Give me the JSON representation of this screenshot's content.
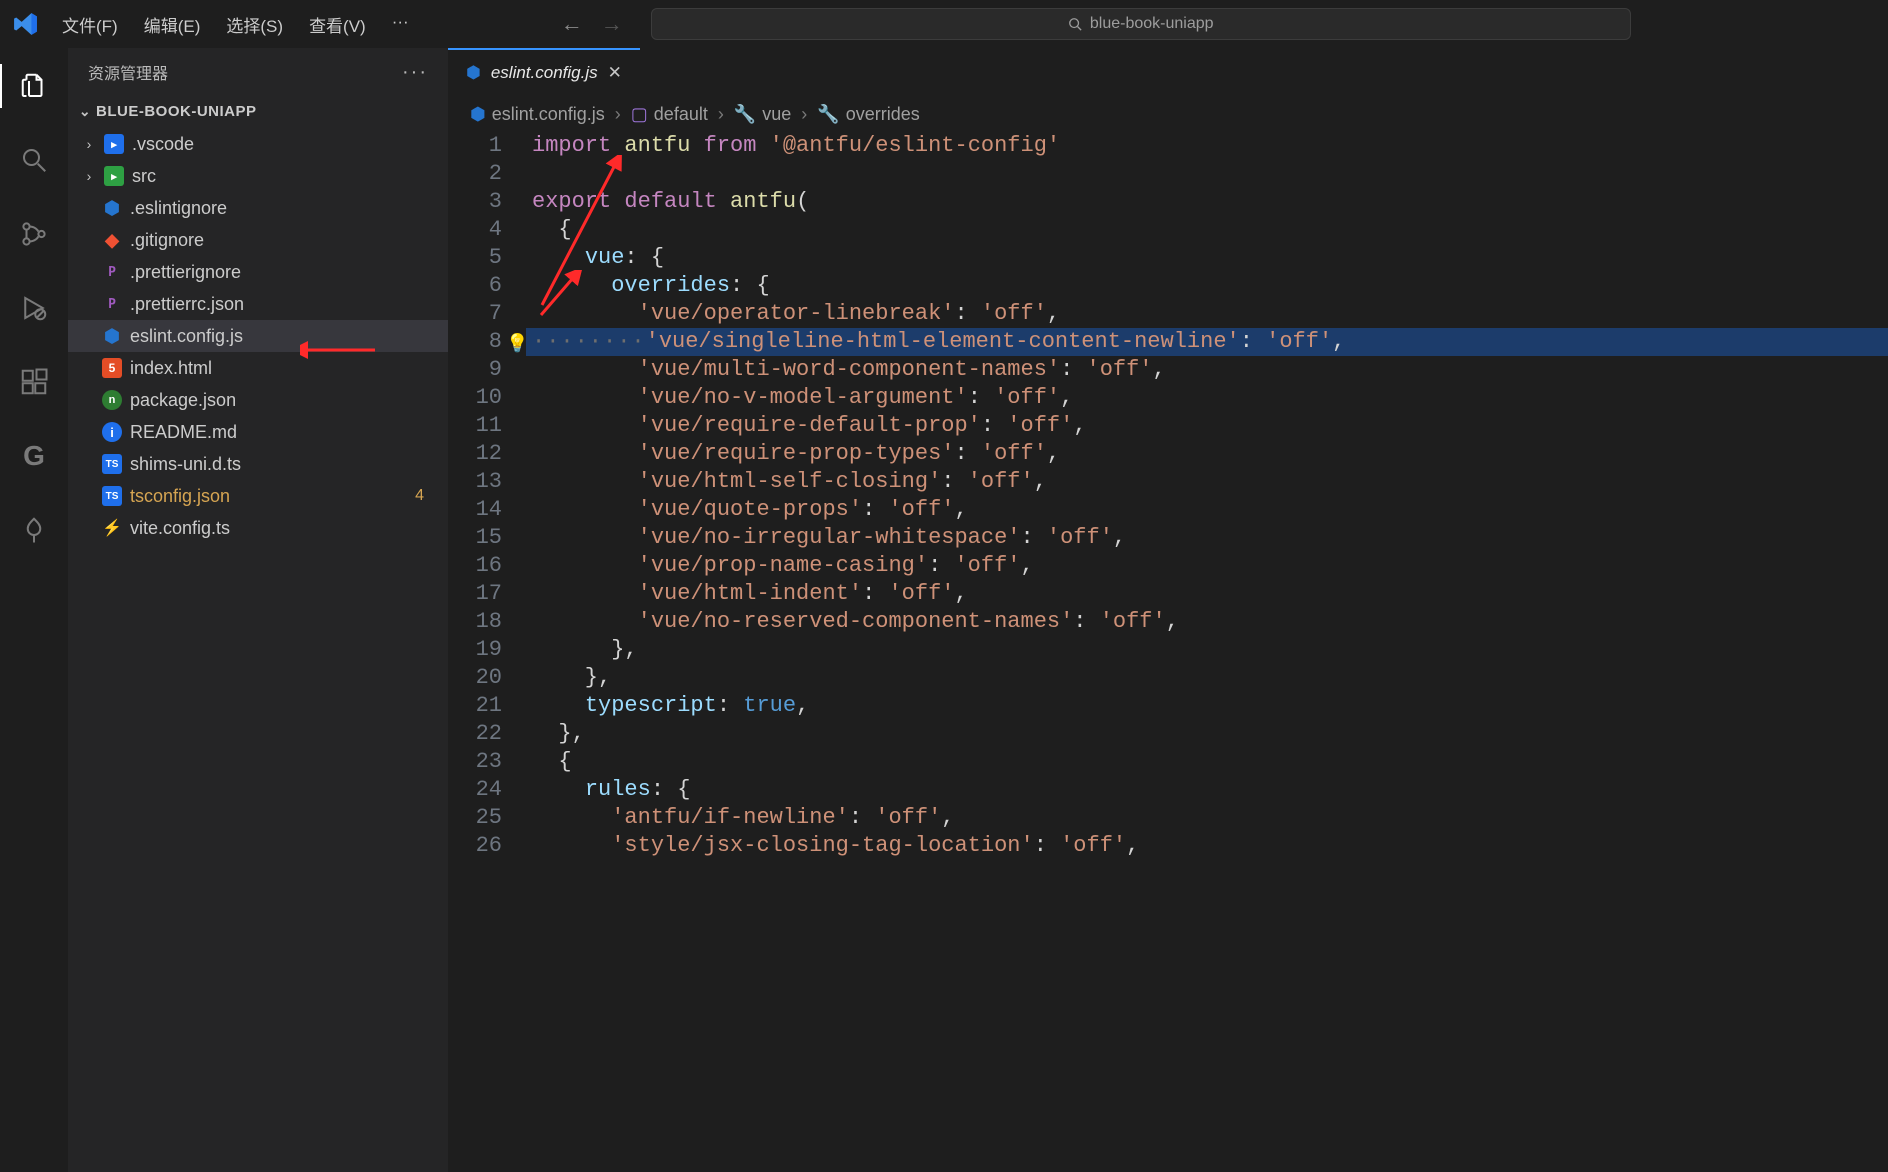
{
  "titlebar": {
    "menu": [
      "文件(F)",
      "编辑(E)",
      "选择(S)",
      "查看(V)",
      "···"
    ],
    "search_label": "blue-book-uniapp"
  },
  "sidebar": {
    "title": "资源管理器",
    "project": "BLUE-BOOK-UNIAPP",
    "rows": [
      {
        "kind": "folder",
        "chev": "›",
        "icon": "folder-blue",
        "label": ".vscode"
      },
      {
        "kind": "folder",
        "chev": "›",
        "icon": "folder-green",
        "label": "src"
      },
      {
        "kind": "file",
        "icon": "hex-blue",
        "label": ".eslintignore"
      },
      {
        "kind": "file",
        "icon": "git",
        "label": ".gitignore"
      },
      {
        "kind": "file",
        "icon": "p",
        "label": ".prettierignore"
      },
      {
        "kind": "file",
        "icon": "p",
        "label": ".prettierrc.json"
      },
      {
        "kind": "file",
        "icon": "hex-blue",
        "label": "eslint.config.js",
        "selected": true
      },
      {
        "kind": "file",
        "icon": "html",
        "label": "index.html"
      },
      {
        "kind": "file",
        "icon": "npm",
        "label": "package.json"
      },
      {
        "kind": "file",
        "icon": "info",
        "label": "README.md"
      },
      {
        "kind": "file",
        "icon": "ts",
        "label": "shims-uni.d.ts"
      },
      {
        "kind": "file",
        "icon": "ts",
        "label": "tsconfig.json",
        "warn": true,
        "badge": "4"
      },
      {
        "kind": "file",
        "icon": "bolt",
        "label": "vite.config.ts"
      }
    ]
  },
  "tab": {
    "icon": "hex-blue",
    "label": "eslint.config.js"
  },
  "breadcrumb": [
    {
      "icon": "hex-blue",
      "label": "eslint.config.js"
    },
    {
      "icon": "symbol",
      "label": "default"
    },
    {
      "icon": "wrench",
      "label": "vue"
    },
    {
      "icon": "wrench",
      "label": "overrides"
    }
  ],
  "code": {
    "lines": [
      {
        "n": 1,
        "seg": [
          [
            "kw",
            "import "
          ],
          [
            "fn",
            "antfu "
          ],
          [
            "kw",
            "from "
          ],
          [
            "str",
            "'@antfu/eslint-config'"
          ]
        ]
      },
      {
        "n": 2,
        "seg": []
      },
      {
        "n": 3,
        "seg": [
          [
            "kw",
            "export "
          ],
          [
            "kw",
            "default "
          ],
          [
            "fn",
            "antfu"
          ],
          [
            "pl",
            "("
          ]
        ]
      },
      {
        "n": 4,
        "seg": [
          [
            "pl",
            "  {"
          ]
        ]
      },
      {
        "n": 5,
        "seg": [
          [
            "pl",
            "    "
          ],
          [
            "id",
            "vue"
          ],
          [
            "pl",
            ": {"
          ]
        ]
      },
      {
        "n": 6,
        "seg": [
          [
            "pl",
            "      "
          ],
          [
            "id",
            "overrides"
          ],
          [
            "pl",
            ": {"
          ]
        ]
      },
      {
        "n": 7,
        "seg": [
          [
            "pl",
            "        "
          ],
          [
            "str",
            "'vue/operator-linebreak'"
          ],
          [
            "pl",
            ": "
          ],
          [
            "str",
            "'off'"
          ],
          [
            "pl",
            ","
          ]
        ]
      },
      {
        "n": 8,
        "hl": true,
        "bulb": true,
        "seg": [
          [
            "dots",
            "········"
          ],
          [
            "str",
            "'vue/singleline-html-element-content-newline'"
          ],
          [
            "pl",
            ": "
          ],
          [
            "str",
            "'off'"
          ],
          [
            "pl",
            ","
          ]
        ]
      },
      {
        "n": 9,
        "seg": [
          [
            "pl",
            "        "
          ],
          [
            "str",
            "'vue/multi-word-component-names'"
          ],
          [
            "pl",
            ": "
          ],
          [
            "str",
            "'off'"
          ],
          [
            "pl",
            ","
          ]
        ]
      },
      {
        "n": 10,
        "seg": [
          [
            "pl",
            "        "
          ],
          [
            "str",
            "'vue/no-v-model-argument'"
          ],
          [
            "pl",
            ": "
          ],
          [
            "str",
            "'off'"
          ],
          [
            "pl",
            ","
          ]
        ]
      },
      {
        "n": 11,
        "seg": [
          [
            "pl",
            "        "
          ],
          [
            "str",
            "'vue/require-default-prop'"
          ],
          [
            "pl",
            ": "
          ],
          [
            "str",
            "'off'"
          ],
          [
            "pl",
            ","
          ]
        ]
      },
      {
        "n": 12,
        "seg": [
          [
            "pl",
            "        "
          ],
          [
            "str",
            "'vue/require-prop-types'"
          ],
          [
            "pl",
            ": "
          ],
          [
            "str",
            "'off'"
          ],
          [
            "pl",
            ","
          ]
        ]
      },
      {
        "n": 13,
        "seg": [
          [
            "pl",
            "        "
          ],
          [
            "str",
            "'vue/html-self-closing'"
          ],
          [
            "pl",
            ": "
          ],
          [
            "str",
            "'off'"
          ],
          [
            "pl",
            ","
          ]
        ]
      },
      {
        "n": 14,
        "seg": [
          [
            "pl",
            "        "
          ],
          [
            "str",
            "'vue/quote-props'"
          ],
          [
            "pl",
            ": "
          ],
          [
            "str",
            "'off'"
          ],
          [
            "pl",
            ","
          ]
        ]
      },
      {
        "n": 15,
        "seg": [
          [
            "pl",
            "        "
          ],
          [
            "str",
            "'vue/no-irregular-whitespace'"
          ],
          [
            "pl",
            ": "
          ],
          [
            "str",
            "'off'"
          ],
          [
            "pl",
            ","
          ]
        ]
      },
      {
        "n": 16,
        "seg": [
          [
            "pl",
            "        "
          ],
          [
            "str",
            "'vue/prop-name-casing'"
          ],
          [
            "pl",
            ": "
          ],
          [
            "str",
            "'off'"
          ],
          [
            "pl",
            ","
          ]
        ]
      },
      {
        "n": 17,
        "seg": [
          [
            "pl",
            "        "
          ],
          [
            "str",
            "'vue/html-indent'"
          ],
          [
            "pl",
            ": "
          ],
          [
            "str",
            "'off'"
          ],
          [
            "pl",
            ","
          ]
        ]
      },
      {
        "n": 18,
        "seg": [
          [
            "pl",
            "        "
          ],
          [
            "str",
            "'vue/no-reserved-component-names'"
          ],
          [
            "pl",
            ": "
          ],
          [
            "str",
            "'off'"
          ],
          [
            "pl",
            ","
          ]
        ]
      },
      {
        "n": 19,
        "seg": [
          [
            "pl",
            "      },"
          ]
        ]
      },
      {
        "n": 20,
        "seg": [
          [
            "pl",
            "    },"
          ]
        ]
      },
      {
        "n": 21,
        "seg": [
          [
            "pl",
            "    "
          ],
          [
            "id",
            "typescript"
          ],
          [
            "pl",
            ": "
          ],
          [
            "bool",
            "true"
          ],
          [
            "pl",
            ","
          ]
        ]
      },
      {
        "n": 22,
        "seg": [
          [
            "pl",
            "  },"
          ]
        ]
      },
      {
        "n": 23,
        "seg": [
          [
            "pl",
            "  {"
          ]
        ]
      },
      {
        "n": 24,
        "seg": [
          [
            "pl",
            "    "
          ],
          [
            "id",
            "rules"
          ],
          [
            "pl",
            ": {"
          ]
        ]
      },
      {
        "n": 25,
        "seg": [
          [
            "pl",
            "      "
          ],
          [
            "str",
            "'antfu/if-newline'"
          ],
          [
            "pl",
            ": "
          ],
          [
            "str",
            "'off'"
          ],
          [
            "pl",
            ","
          ]
        ]
      },
      {
        "n": 26,
        "seg": [
          [
            "pl",
            "      "
          ],
          [
            "str",
            "'style/jsx-closing-tag-location'"
          ],
          [
            "pl",
            ": "
          ],
          [
            "str",
            "'off'"
          ],
          [
            "pl",
            ","
          ]
        ]
      }
    ]
  }
}
